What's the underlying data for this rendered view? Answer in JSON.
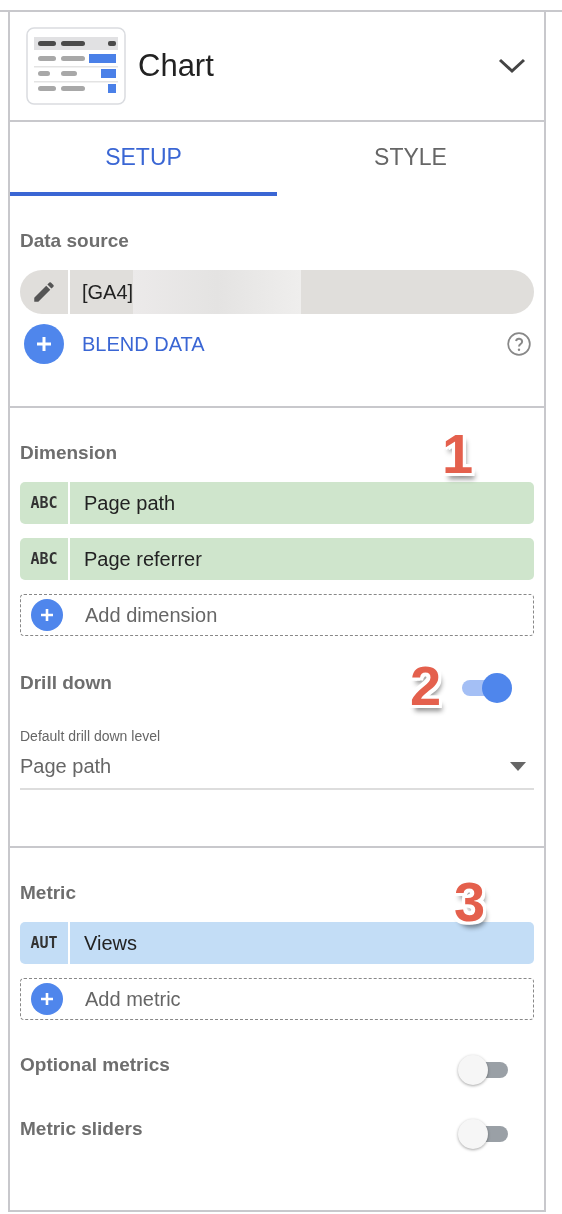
{
  "header": {
    "title": "Chart"
  },
  "tabs": [
    {
      "label": "SETUP",
      "selected": true
    },
    {
      "label": "STYLE",
      "selected": false
    }
  ],
  "data_source": {
    "label": "Data source",
    "value": "[GA4]",
    "blend_label": "BLEND DATA"
  },
  "dimension": {
    "label": "Dimension",
    "annotation": "1",
    "add_label": "Add dimension",
    "fields": [
      {
        "kind": "dimension",
        "type_label": "ABC",
        "name": "Page path"
      },
      {
        "kind": "dimension",
        "type_label": "ABC",
        "name": "Page referrer"
      }
    ]
  },
  "drill_down": {
    "label": "Drill down",
    "annotation": "2",
    "on": true,
    "level_label": "Default drill down level",
    "level_value": "Page path"
  },
  "metric": {
    "label": "Metric",
    "annotation": "3",
    "add_label": "Add metric",
    "fields": [
      {
        "kind": "metric",
        "type_label": "AUT",
        "name": "Views"
      }
    ]
  },
  "options": [
    {
      "label": "Optional metrics",
      "on": false
    },
    {
      "label": "Metric sliders",
      "on": false
    }
  ]
}
